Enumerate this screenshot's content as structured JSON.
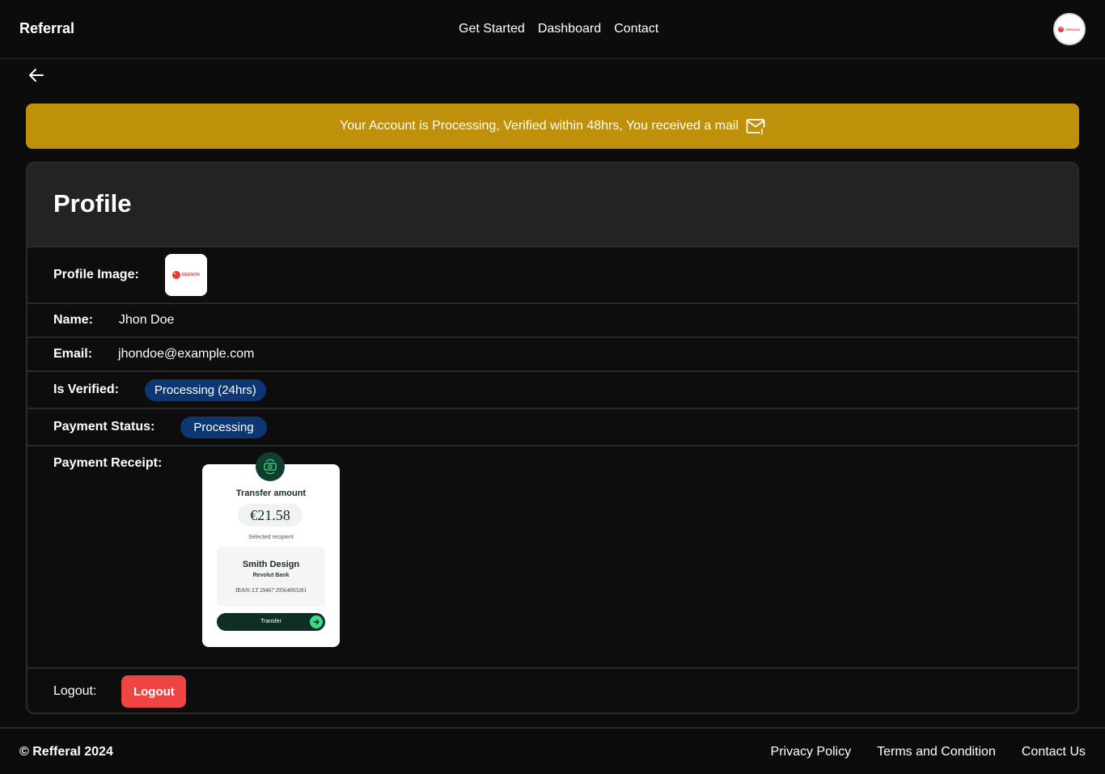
{
  "header": {
    "brand": "Referral",
    "nav": [
      "Get Started",
      "Dashboard",
      "Contact"
    ],
    "avatar_logo_text": "SEENON"
  },
  "banner": {
    "message": "Your Account is Processing, Verified within 48hrs, You received a mail",
    "icon": "mail-icon",
    "color": "#bf900a"
  },
  "profile": {
    "title": "Profile",
    "image_label": "Profile Image:",
    "image_logo_text": "SEENON",
    "name_label": "Name:",
    "name": "Jhon Doe",
    "email_label": "Email:",
    "email": "jhondoe@example.com",
    "verified_label": "Is Verified:",
    "verified_status": "Processing (24hrs)",
    "payment_label": "Payment Status:",
    "payment_status": "Processing",
    "receipt_label": "Payment Receipt:",
    "logout_label": "Logout:",
    "logout_button": "Logout"
  },
  "receipt": {
    "title": "Transfer amount",
    "amount": "€21.58",
    "selected": "Selected recipient",
    "recipient_name": "Smith Design",
    "bank": "Revolut Bank",
    "iban": "IBAN: LT 29467 29564003281",
    "button": "Transfer"
  },
  "footer": {
    "copyright": "© Refferal 2024",
    "links": [
      "Privacy Policy",
      "Terms and Condition",
      "Contact Us"
    ]
  },
  "colors": {
    "badge": "#0d3772",
    "logout": "#ef4444",
    "receipt_dark": "#0f2f25"
  }
}
